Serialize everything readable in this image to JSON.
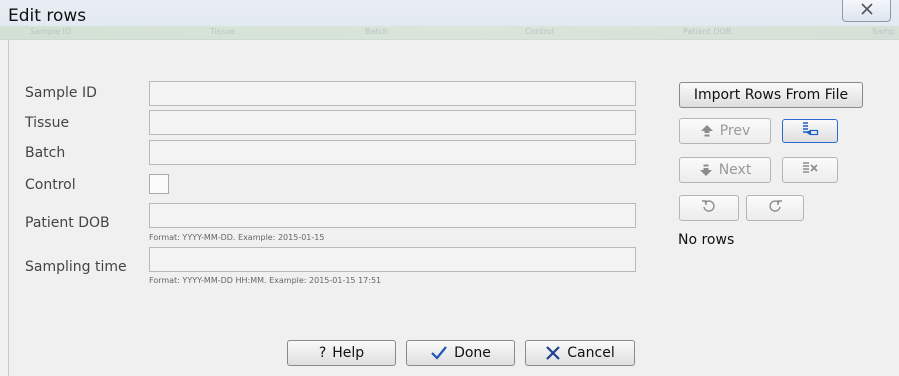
{
  "window": {
    "title": "Edit rows"
  },
  "background_columns": [
    "Sample ID",
    "Tissue",
    "Batch",
    "Control",
    "Patient DOB",
    "Samp"
  ],
  "form": {
    "fields": [
      {
        "label": "Sample ID",
        "value": ""
      },
      {
        "label": "Tissue",
        "value": ""
      },
      {
        "label": "Batch",
        "value": ""
      },
      {
        "label": "Control",
        "checked": false
      },
      {
        "label": "Patient DOB",
        "value": "",
        "hint": "Format: YYYY-MM-DD. Example: 2015-01-15"
      },
      {
        "label": "Sampling time",
        "value": "",
        "hint": "Format: YYYY-MM-DD HH:MM. Example: 2015-01-15 17:51"
      }
    ]
  },
  "side_panel": {
    "import_label": "Import Rows From File",
    "prev_label": "Prev",
    "next_label": "Next",
    "status": "No rows"
  },
  "footer": {
    "help_label": "Help",
    "done_label": "Done",
    "cancel_label": "Cancel"
  },
  "icons": {
    "close": "close-icon",
    "prev": "arrow-up-icon",
    "next": "arrow-down-icon",
    "insert": "insert-row-icon",
    "delete": "delete-row-icon",
    "undo": "undo-icon",
    "redo": "redo-icon",
    "help": "question-icon",
    "done": "checkmark-icon",
    "cancel": "x-icon"
  },
  "colors": {
    "accent_blue": "#1f5fbf",
    "done_check": "#2056b8",
    "cancel_x": "#1d3f8f"
  }
}
